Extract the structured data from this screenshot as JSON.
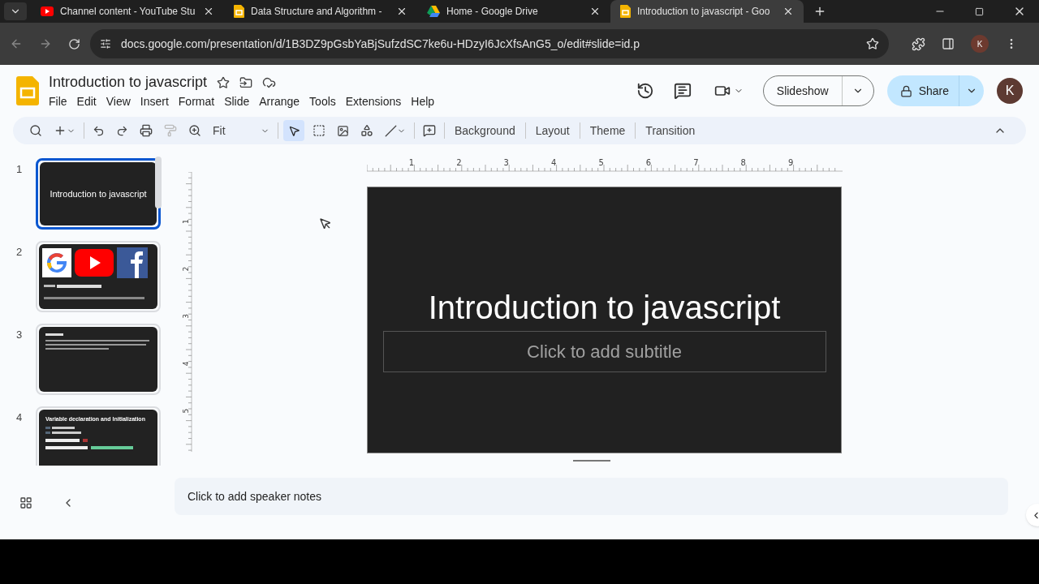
{
  "browser": {
    "tabs": [
      {
        "title": "Channel content - YouTube Stu",
        "kind": "youtube",
        "selected": false
      },
      {
        "title": "Data Structure and Algorithm -",
        "kind": "slides",
        "selected": false
      },
      {
        "title": "Home - Google Drive",
        "kind": "drive",
        "selected": false
      },
      {
        "title": "Introduction to javascript - Goo",
        "kind": "slides",
        "selected": true
      }
    ],
    "url": "docs.google.com/presentation/d/1B3DZ9pGsbYaBjSufzdSC7ke6u-HDzyI6JcXfsAnG5_o/edit#slide=id.p",
    "profile": "K"
  },
  "doc": {
    "title": "Introduction to javascript",
    "menu": [
      "File",
      "Edit",
      "View",
      "Insert",
      "Format",
      "Slide",
      "Arrange",
      "Tools",
      "Extensions",
      "Help"
    ],
    "slideshow": "Slideshow",
    "share": "Share",
    "avatar": "K"
  },
  "toolbar": {
    "zoom": "Fit",
    "actions": [
      "Background",
      "Layout",
      "Theme",
      "Transition"
    ]
  },
  "slides": [
    {
      "number": "1",
      "kind": "title",
      "selected": true,
      "title": "Introduction to javascript"
    },
    {
      "number": "2",
      "kind": "logos",
      "selected": false
    },
    {
      "number": "3",
      "kind": "text",
      "selected": false
    },
    {
      "number": "4",
      "kind": "code",
      "selected": false,
      "title": "Variable declaration and Initialization"
    }
  ],
  "ruler_h": [
    "1",
    "2",
    "3",
    "4",
    "5",
    "6",
    "7",
    "8",
    "9"
  ],
  "ruler_v": [
    "1",
    "2",
    "3",
    "4",
    "5"
  ],
  "canvas": {
    "title": "Introduction to javascript",
    "subtitle_placeholder": "Click to add subtitle"
  },
  "notes": {
    "placeholder": "Click to add speaker notes"
  }
}
